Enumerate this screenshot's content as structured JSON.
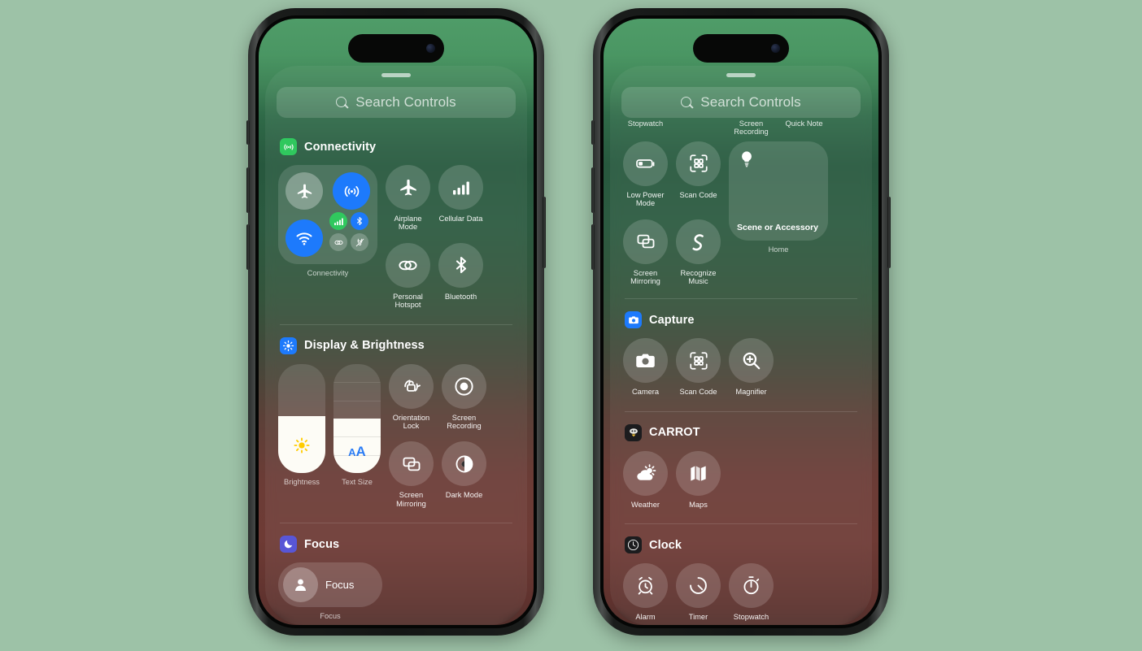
{
  "background_color": "#9dc2a7",
  "accent_colors": {
    "blue": "#1d7afc",
    "green": "#30c85e",
    "focus_purple": "#5856d6",
    "slider_fill": "#fdfcf6",
    "brightness_yellow": "#ffcc00",
    "text_size_blue": "#2b7df6"
  },
  "phones": [
    {
      "id": "left-phone",
      "search": {
        "placeholder": "Search Controls",
        "icon": "search-icon"
      },
      "sections": [
        {
          "id": "connectivity",
          "title": "Connectivity",
          "icon": "connectivity-icon",
          "icon_color": "#30c85e",
          "module": {
            "label": "Connectivity",
            "toggles": [
              {
                "name": "airplane-mode",
                "state": "off"
              },
              {
                "name": "airdrop",
                "state": "on"
              },
              {
                "name": "wifi",
                "state": "on"
              },
              {
                "name": "cellular-data",
                "state": "on"
              },
              {
                "name": "bluetooth",
                "state": "on"
              },
              {
                "name": "vpn",
                "state": "off"
              },
              {
                "name": "satellite",
                "state": "off"
              }
            ]
          },
          "tiles": [
            {
              "label": "Airplane Mode",
              "icon": "airplane-icon"
            },
            {
              "label": "Cellular Data",
              "icon": "cellular-bars-icon"
            },
            {
              "label": "Personal Hotspot",
              "icon": "hotspot-link-icon"
            },
            {
              "label": "Bluetooth",
              "icon": "bluetooth-icon"
            }
          ]
        },
        {
          "id": "display-brightness",
          "title": "Display & Brightness",
          "icon": "brightness-icon",
          "icon_color": "#1d7afc",
          "sliders": [
            {
              "label": "Brightness",
              "icon": "sun-icon",
              "fill_percent": 52
            },
            {
              "label": "Text Size",
              "icon": "text-size-icon",
              "fill_percent": 50
            }
          ],
          "tiles": [
            {
              "label": "Orientation Lock",
              "icon": "rotation-lock-icon"
            },
            {
              "label": "Screen Recording",
              "icon": "record-icon"
            },
            {
              "label": "Screen Mirroring",
              "icon": "screen-mirroring-icon"
            },
            {
              "label": "Dark Mode",
              "icon": "dark-mode-icon"
            }
          ]
        },
        {
          "id": "focus",
          "title": "Focus",
          "icon": "moon-icon",
          "icon_color": "#5856d6",
          "pill": {
            "label": "Focus",
            "caption": "Focus",
            "icon": "person-icon"
          }
        }
      ]
    },
    {
      "id": "right-phone",
      "search": {
        "placeholder": "Search Controls",
        "icon": "search-icon"
      },
      "clipped_top_labels": [
        "Stopwatch",
        "Screen Recording",
        "Quick Note"
      ],
      "sections": [
        {
          "id": "home-top",
          "title": "",
          "tiles": [
            {
              "label": "Low Power Mode",
              "icon": "battery-low-icon"
            },
            {
              "label": "Scan Code",
              "icon": "qr-scan-icon"
            },
            {
              "label": "Screen Mirroring",
              "icon": "screen-mirroring-icon"
            },
            {
              "label": "Recognize Music",
              "icon": "shazam-icon"
            }
          ],
          "widget": {
            "label": "Scene or Accessory",
            "caption": "Home",
            "icon": "lightbulb-icon"
          }
        },
        {
          "id": "capture",
          "title": "Capture",
          "icon": "camera-icon",
          "icon_color": "#1d7afc",
          "tiles": [
            {
              "label": "Camera",
              "icon": "camera-icon"
            },
            {
              "label": "Scan Code",
              "icon": "qr-scan-icon"
            },
            {
              "label": "Magnifier",
              "icon": "magnifier-plus-icon"
            }
          ]
        },
        {
          "id": "carrot",
          "title": "CARROT",
          "icon": "carrot-app-icon",
          "icon_color": "#1c1c1e",
          "tiles": [
            {
              "label": "Weather",
              "icon": "weather-sun-cloud-icon"
            },
            {
              "label": "Maps",
              "icon": "map-icon"
            }
          ]
        },
        {
          "id": "clock",
          "title": "Clock",
          "icon": "clock-app-icon",
          "icon_color": "#1c1c1e",
          "tiles": [
            {
              "label": "Alarm",
              "icon": "alarm-clock-icon"
            },
            {
              "label": "Timer",
              "icon": "timer-icon"
            },
            {
              "label": "Stopwatch",
              "icon": "stopwatch-icon"
            }
          ]
        }
      ]
    }
  ]
}
